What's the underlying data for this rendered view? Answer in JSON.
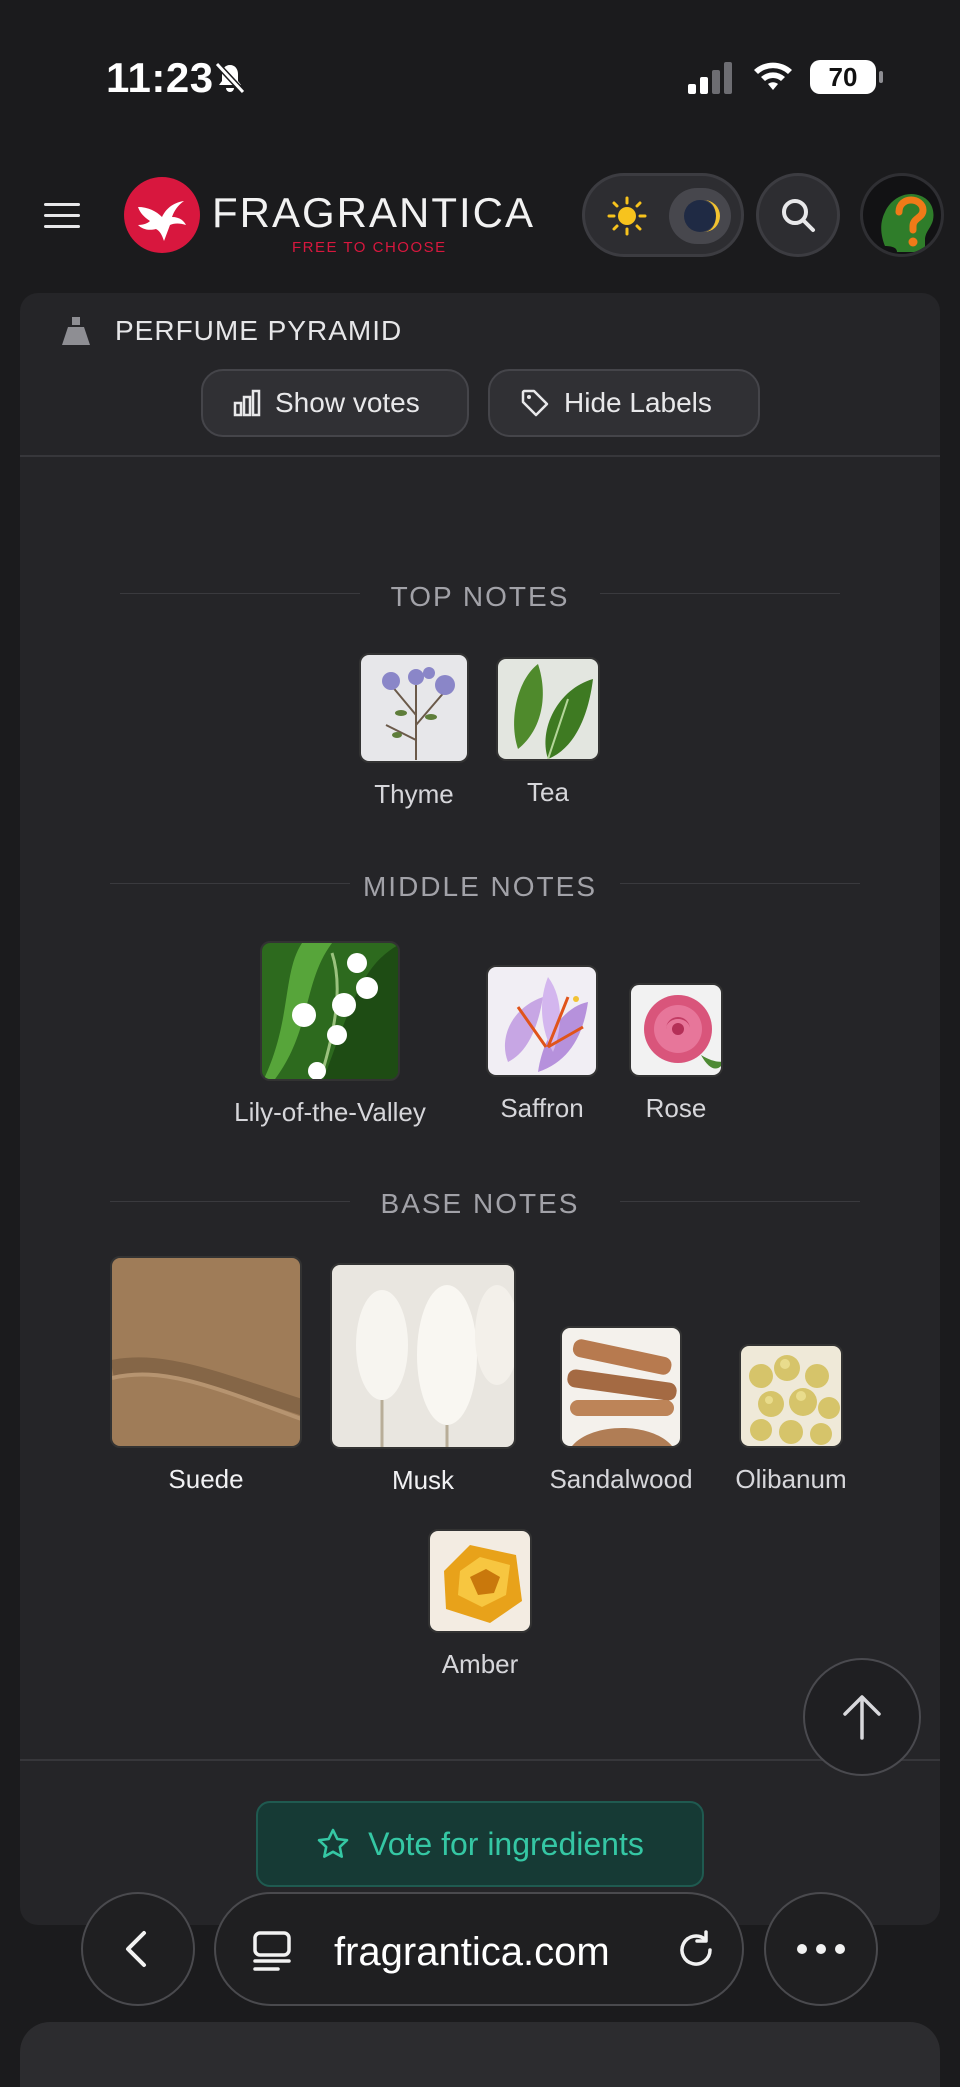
{
  "status": {
    "time": "11:23",
    "battery": "70"
  },
  "header": {
    "logo_name": "FRAGRANTICA",
    "logo_tagline": "FREE TO CHOOSE"
  },
  "pyramid": {
    "title": "PERFUME PYRAMID",
    "show_votes_label": "Show votes",
    "hide_labels_label": "Hide Labels",
    "sections": {
      "top": {
        "title": "TOP NOTES",
        "notes": [
          "Thyme",
          "Tea"
        ]
      },
      "middle": {
        "title": "MIDDLE NOTES",
        "notes": [
          "Lily-of-the-Valley",
          "Saffron",
          "Rose"
        ]
      },
      "base": {
        "title": "BASE NOTES",
        "notes": [
          "Suede",
          "Musk",
          "Sandalwood",
          "Olibanum",
          "Amber"
        ]
      }
    },
    "vote_button_label": "Vote for ingredients"
  },
  "browser": {
    "url": "fragrantica.com"
  },
  "colors": {
    "brand": "#d8173e",
    "vote_accent": "#35c7a4"
  }
}
